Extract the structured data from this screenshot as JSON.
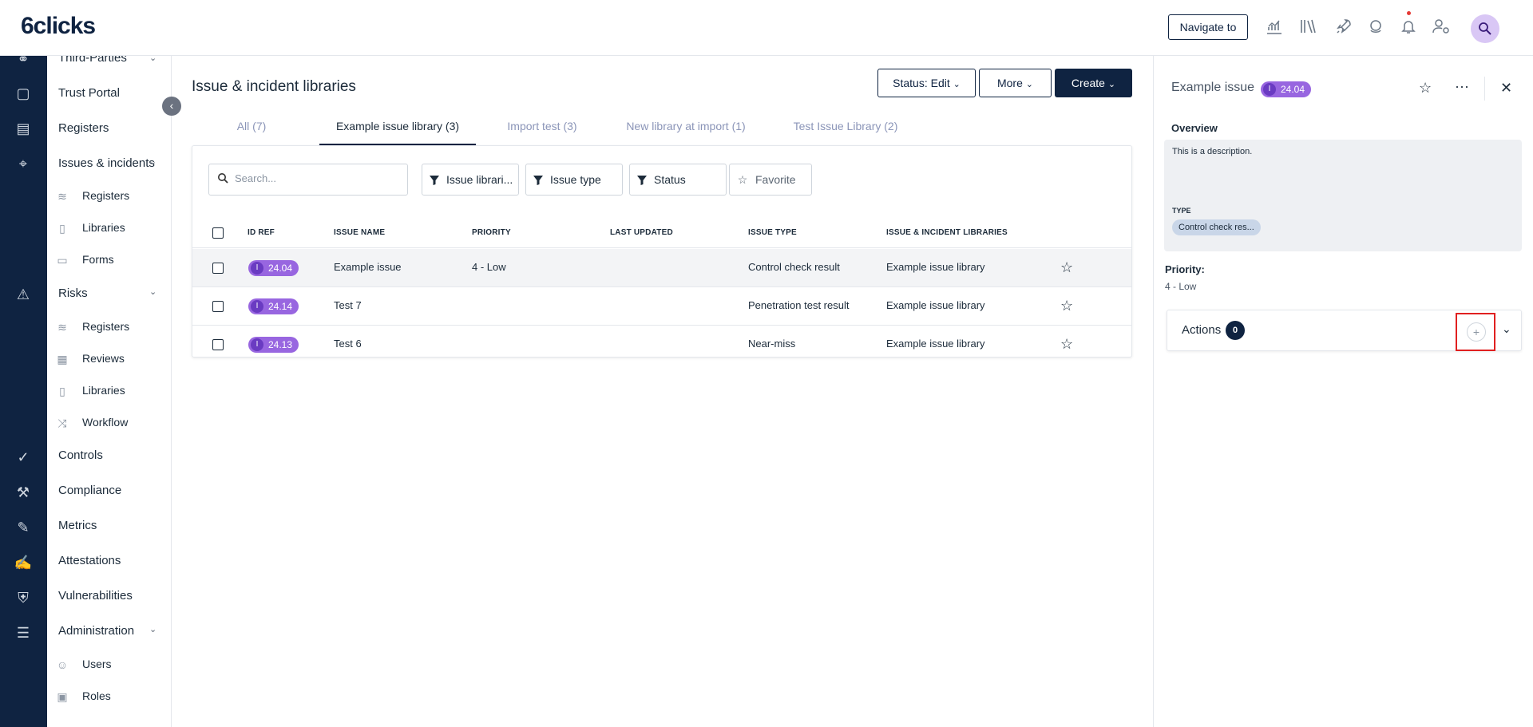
{
  "app": {
    "logo": "6clicks"
  },
  "topbar": {
    "navigate_label": "Navigate to",
    "icons": [
      "analytics-icon",
      "library-icon",
      "rocket-icon",
      "support-icon",
      "bell-icon",
      "user-settings-icon",
      "account-icon"
    ],
    "avatar_glyph": "🔍"
  },
  "sidenav": {
    "items": [
      {
        "label": "Third-Parties"
      },
      {
        "label": "Trust Portal"
      },
      {
        "label": "Registers"
      },
      {
        "label": "Issues & incidents"
      },
      {
        "label": "Registers"
      },
      {
        "label": "Libraries"
      },
      {
        "label": "Forms"
      },
      {
        "label": "Risks"
      },
      {
        "label": "Registers"
      },
      {
        "label": "Reviews"
      },
      {
        "label": "Libraries"
      },
      {
        "label": "Workflow"
      },
      {
        "label": "Controls"
      },
      {
        "label": "Compliance"
      },
      {
        "label": "Metrics"
      },
      {
        "label": "Attestations"
      },
      {
        "label": "Vulnerabilities"
      },
      {
        "label": "Administration"
      },
      {
        "label": "Users"
      },
      {
        "label": "Roles"
      }
    ]
  },
  "main": {
    "title": "Issue & incident libraries",
    "status_label": "Status: ",
    "status_value": "Edit",
    "more_label": "More",
    "create_label": "Create",
    "tabs": [
      {
        "label": "All (7)"
      },
      {
        "label": "Example issue library (3)"
      },
      {
        "label": "Import test (3)"
      },
      {
        "label": "New library at import (1)"
      },
      {
        "label": "Test Issue Library (2)"
      }
    ],
    "search_placeholder": "Search...",
    "filters": [
      {
        "label": "Issue librari..."
      },
      {
        "label": "Issue type"
      },
      {
        "label": "Status"
      }
    ],
    "favorite_label": "Favorite",
    "columns": [
      "ID REF",
      "ISSUE NAME",
      "PRIORITY",
      "LAST UPDATED",
      "ISSUE TYPE",
      "ISSUE & INCIDENT LIBRARIES"
    ],
    "rows": [
      {
        "badge_letter": "I",
        "id": "24.04",
        "name": "Example issue",
        "priority": "4 - Low",
        "updated": "",
        "type": "Control check result",
        "library": "Example issue library"
      },
      {
        "badge_letter": "I",
        "id": "24.14",
        "name": "Test 7",
        "priority": "",
        "updated": "",
        "type": "Penetration test result",
        "library": "Example issue library"
      },
      {
        "badge_letter": "I",
        "id": "24.13",
        "name": "Test 6",
        "priority": "",
        "updated": "",
        "type": "Near-miss",
        "library": "Example issue library"
      }
    ]
  },
  "panel": {
    "title": "Example issue",
    "badge_letter": "I",
    "badge_id": "24.04",
    "overview_label": "Overview",
    "description": "This is a description.",
    "type_label": "TYPE",
    "type_value": "Control check res...",
    "priority_label": "Priority:",
    "priority_value": "4 - Low",
    "actions_label": "Actions",
    "actions_count": "0"
  }
}
